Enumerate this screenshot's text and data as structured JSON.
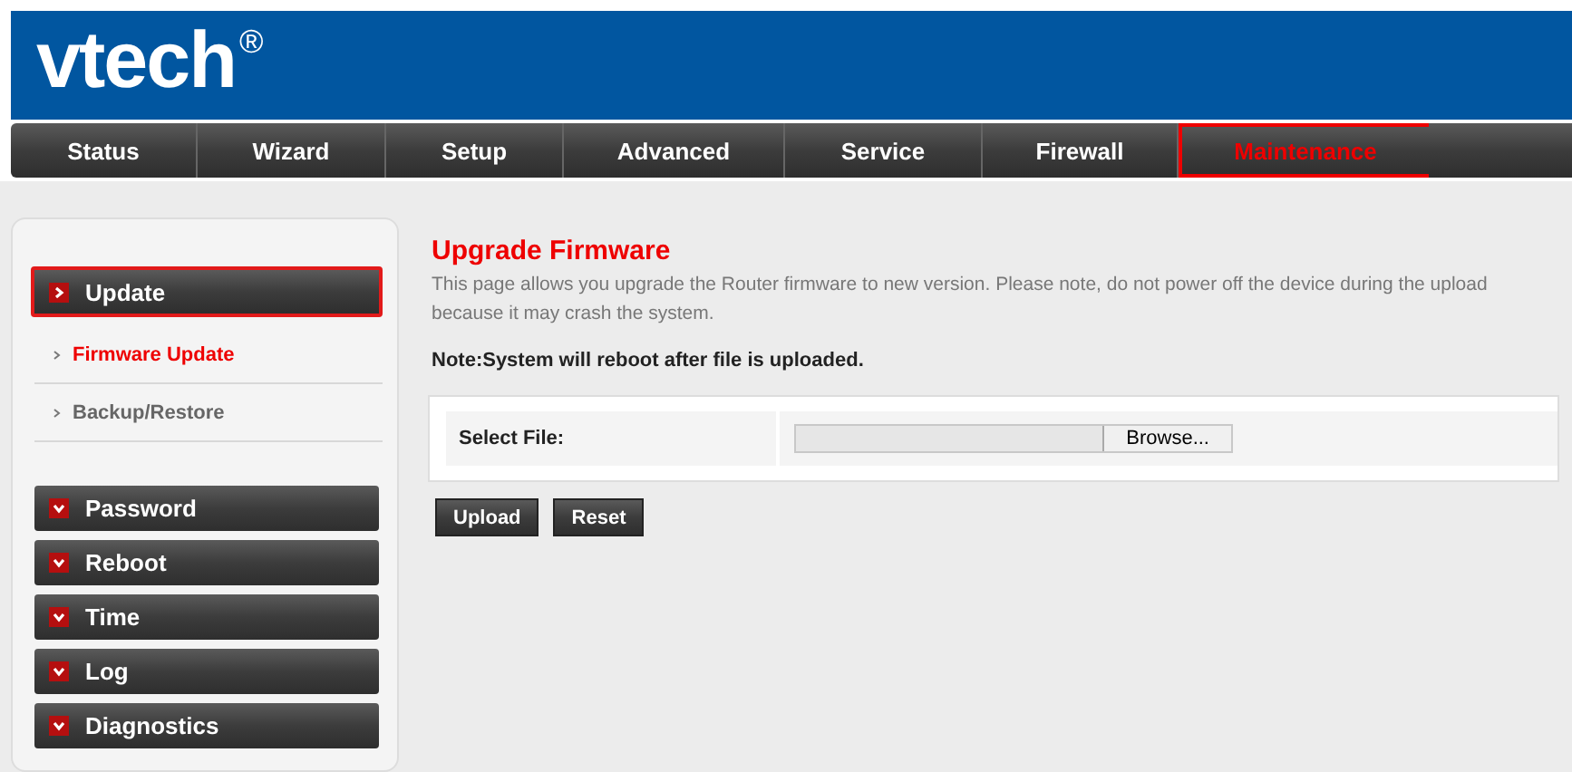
{
  "logo": {
    "text": "vtech",
    "mark": "®"
  },
  "nav": [
    {
      "label": "Status",
      "selected": false
    },
    {
      "label": "Wizard",
      "selected": false
    },
    {
      "label": "Setup",
      "selected": false
    },
    {
      "label": "Advanced",
      "selected": false
    },
    {
      "label": "Service",
      "selected": false
    },
    {
      "label": "Firewall",
      "selected": false
    },
    {
      "label": "Maintenance",
      "selected": true
    }
  ],
  "sidebar": {
    "sections": [
      {
        "label": "Update",
        "expanded": true,
        "selected": true,
        "children": [
          {
            "label": "Firmware Update",
            "selected": true
          },
          {
            "label": "Backup/Restore",
            "selected": false
          }
        ]
      },
      {
        "label": "Password",
        "expanded": false,
        "selected": false
      },
      {
        "label": "Reboot",
        "expanded": false,
        "selected": false
      },
      {
        "label": "Time",
        "expanded": false,
        "selected": false
      },
      {
        "label": "Log",
        "expanded": false,
        "selected": false
      },
      {
        "label": "Diagnostics",
        "expanded": false,
        "selected": false
      }
    ]
  },
  "main": {
    "title": "Upgrade Firmware",
    "description": "This page allows you upgrade the Router firmware to new version. Please note, do not power off the device during the upload because it may crash the system.",
    "note": "Note:System will reboot after file is uploaded.",
    "file_label": "Select File:",
    "browse_button": "Browse...",
    "buttons": [
      "Upload",
      "Reset"
    ]
  }
}
